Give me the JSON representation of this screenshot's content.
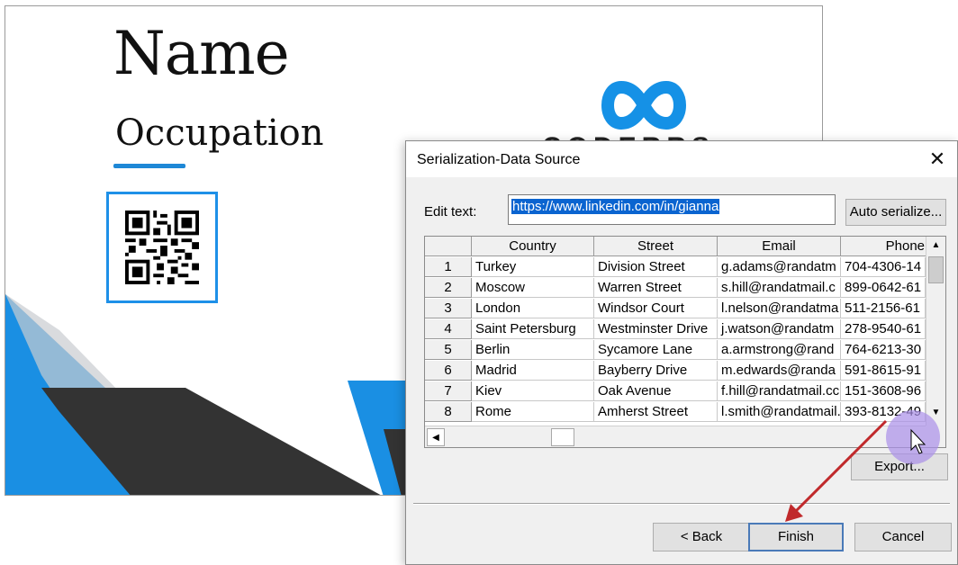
{
  "card": {
    "name": "Name",
    "occupation": "Occupation",
    "logo_text": "CODERRS",
    "colors": {
      "accent": "#1e88d6",
      "dark": "#333333",
      "frame": "#1e90e8"
    }
  },
  "dialog": {
    "title": "Serialization-Data Source",
    "close_glyph": "✕",
    "edit_label": "Edit text:",
    "edit_value": "https://www.linkedin.com/in/gianna",
    "auto_serialize_label": "Auto serialize...",
    "export_label": "Export...",
    "back_label": "< Back",
    "finish_label": "Finish",
    "cancel_label": "Cancel",
    "grid": {
      "columns": [
        "Country",
        "Street",
        "Email",
        "Phone"
      ],
      "rows": [
        {
          "n": "1",
          "cells": [
            "Turkey",
            "Division Street",
            "g.adams@randatm",
            "704-4306-14"
          ]
        },
        {
          "n": "2",
          "cells": [
            "Moscow",
            "Warren Street",
            "s.hill@randatmail.c",
            "899-0642-61"
          ]
        },
        {
          "n": "3",
          "cells": [
            "London",
            "Windsor Court",
            "l.nelson@randatma",
            "511-2156-61"
          ]
        },
        {
          "n": "4",
          "cells": [
            "Saint Petersburg",
            "Westminster Drive",
            "j.watson@randatm",
            "278-9540-61"
          ]
        },
        {
          "n": "5",
          "cells": [
            "Berlin",
            "Sycamore Lane",
            "a.armstrong@rand",
            "764-6213-30"
          ]
        },
        {
          "n": "6",
          "cells": [
            "Madrid",
            "Bayberry Drive",
            "m.edwards@randa",
            "591-8615-91"
          ]
        },
        {
          "n": "7",
          "cells": [
            "Kiev",
            "Oak Avenue",
            "f.hill@randatmail.cc",
            "151-3608-96"
          ]
        },
        {
          "n": "8",
          "cells": [
            "Rome",
            "Amherst Street",
            "l.smith@randatmail.",
            "393-8132-49"
          ]
        }
      ]
    }
  },
  "icons": {
    "close": "close-icon",
    "scroll_up": "chevron-up-icon",
    "scroll_down": "chevron-down-icon",
    "scroll_left": "chevron-left-icon",
    "mouse_cursor": "cursor-icon",
    "annotation": "red-arrow-icon"
  },
  "colors": {
    "selection": "#0a64d0",
    "annotation_arrow": "#c0292b",
    "cursor_highlight": "#a98ee8"
  }
}
